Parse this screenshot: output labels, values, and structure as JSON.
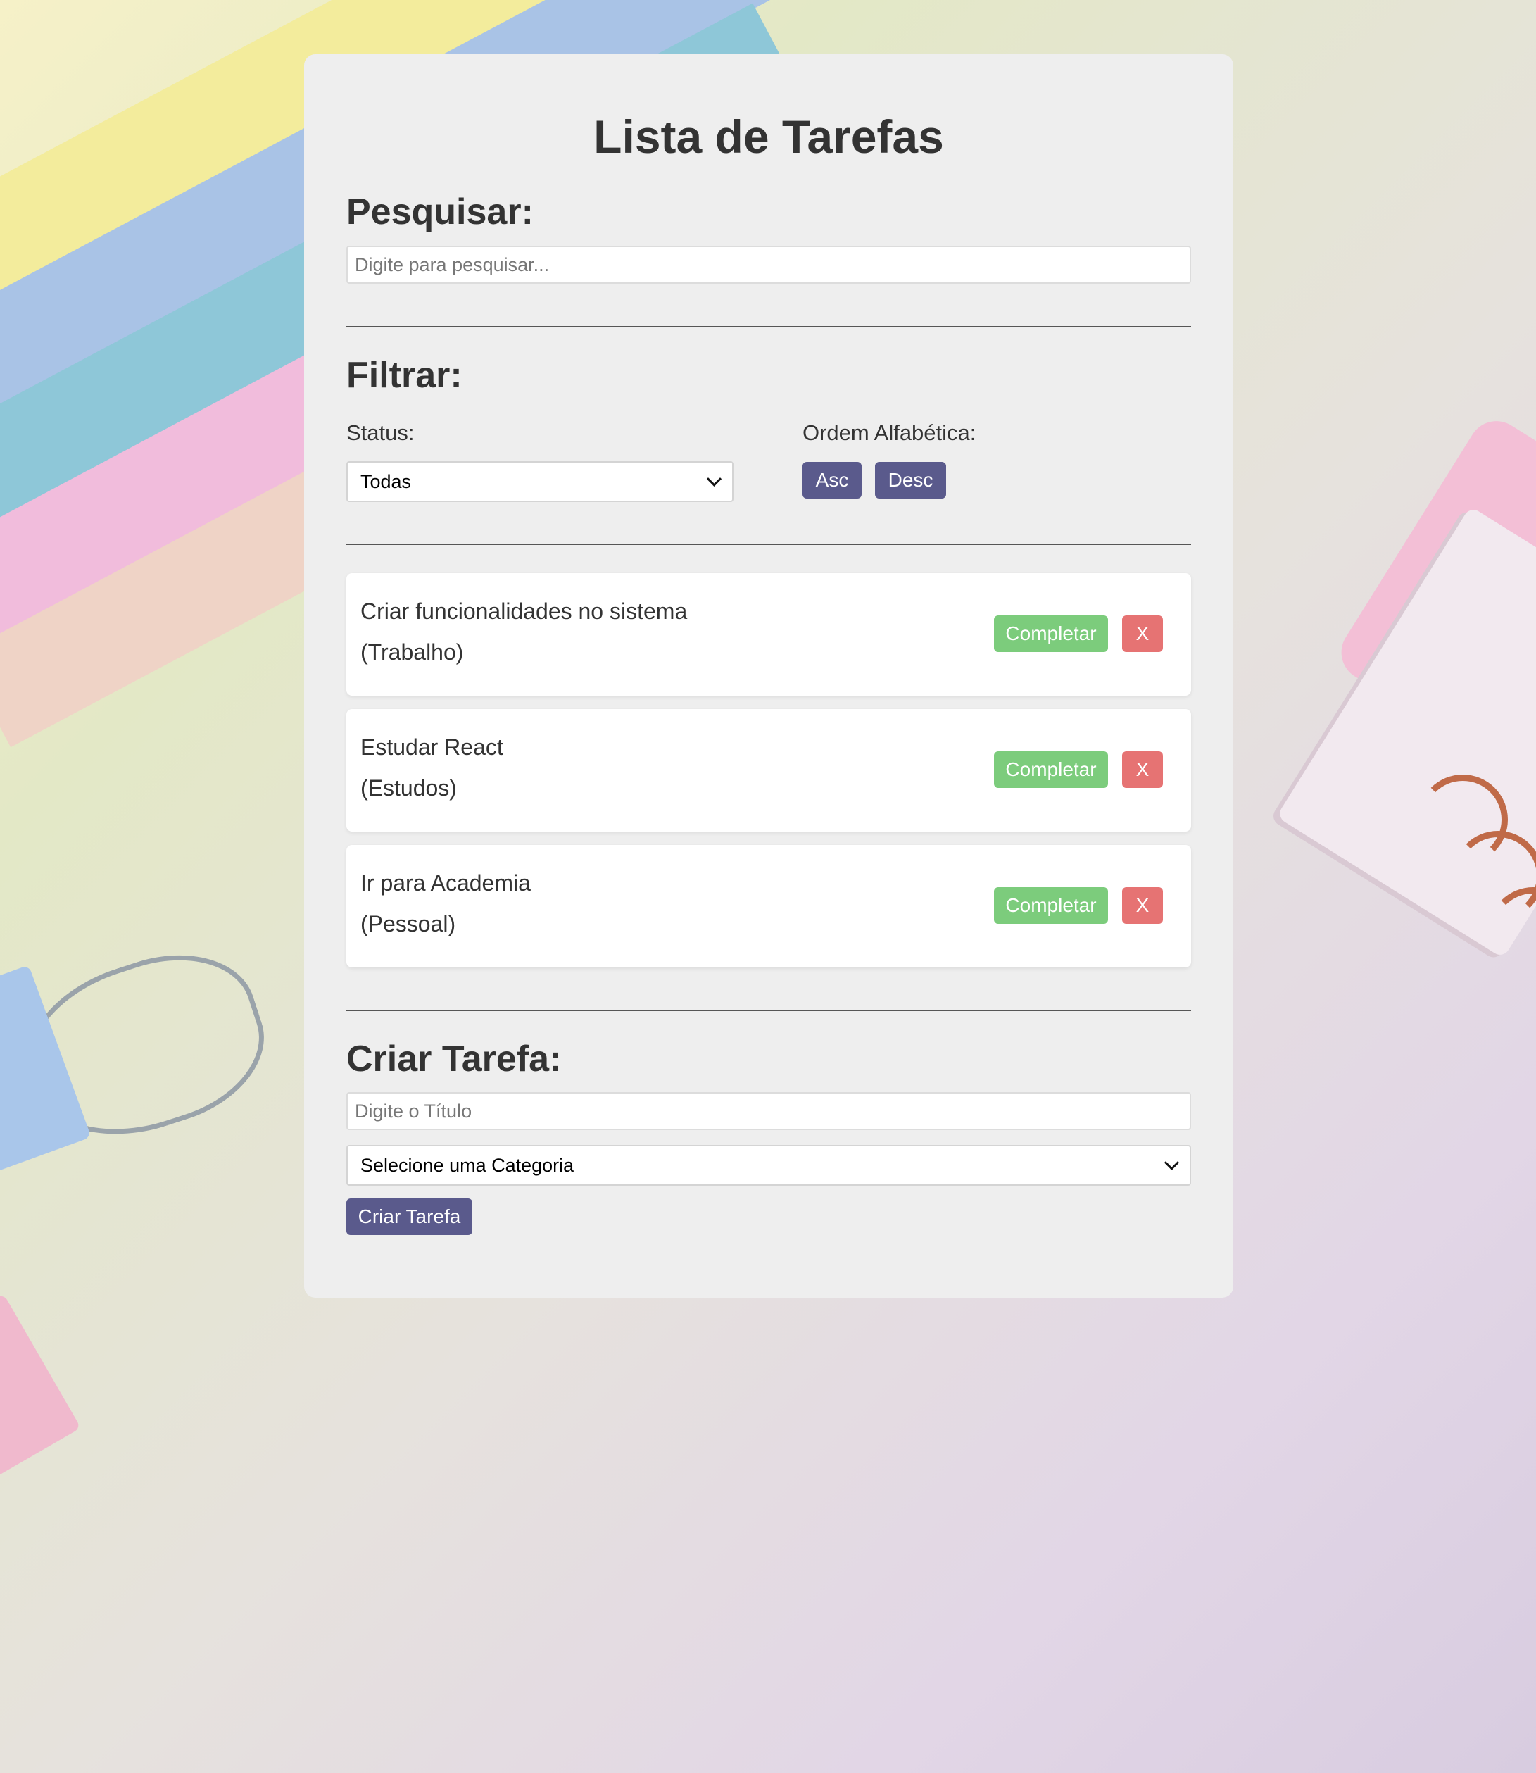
{
  "app": {
    "title": "Lista de Tarefas"
  },
  "search": {
    "heading": "Pesquisar:",
    "placeholder": "Digite para pesquisar..."
  },
  "filter": {
    "heading": "Filtrar:",
    "status_label": "Status:",
    "status_selected": "Todas",
    "order_label": "Ordem Alfabética:",
    "asc_label": "Asc",
    "desc_label": "Desc"
  },
  "tasks": [
    {
      "title": "Criar funcionalidades no sistema",
      "category": "(Trabalho)",
      "complete_label": "Completar",
      "remove_label": "X"
    },
    {
      "title": "Estudar React",
      "category": "(Estudos)",
      "complete_label": "Completar",
      "remove_label": "X"
    },
    {
      "title": "Ir para Academia",
      "category": "(Pessoal)",
      "complete_label": "Completar",
      "remove_label": "X"
    }
  ],
  "create": {
    "heading": "Criar Tarefa:",
    "title_placeholder": "Digite o Título",
    "category_selected": "Selecione uma Categoria",
    "submit_label": "Criar Tarefa"
  },
  "colors": {
    "primary_button": "#5a5a8c",
    "complete_button": "#7ccc7c",
    "remove_button": "#e67373",
    "card_background": "#eeeeee"
  },
  "icons": {
    "select_arrow": "chevron-down-icon"
  }
}
